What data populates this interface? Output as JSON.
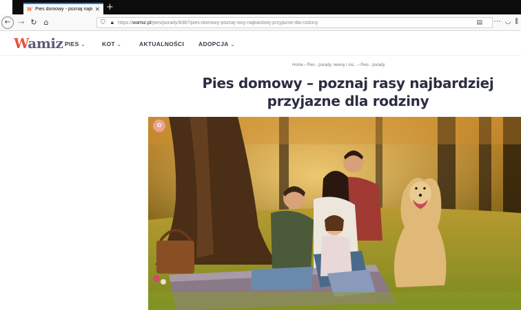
{
  "browser": {
    "tab_title": "Pies domowy - poznaj najlepsze",
    "url_domain": "wamiz.pl",
    "url_prefix": "https://",
    "url_path": "/pies/porady/8387/pies-domowy-poznaj-rasy-najbardziej-przyjazne-dla-rodziny",
    "icons": {
      "back": "arrow-left-icon",
      "forward": "arrow-right-icon",
      "reload": "reload-icon",
      "home": "home-icon",
      "shield": "shield-icon",
      "lock": "lock-icon",
      "reader": "reader-view-icon",
      "more": "more-icon",
      "pocket": "pocket-icon",
      "library": "library-icon"
    },
    "accent_color": "#0a84ff"
  },
  "site": {
    "logo_text_w": "W",
    "logo_text_rest": "amiz",
    "brand_color": "#e8503a",
    "menu": [
      {
        "label": "PIES",
        "has_dropdown": true
      },
      {
        "label": "KOT",
        "has_dropdown": true
      },
      {
        "label": "AKTUALNOŚCI",
        "has_dropdown": false
      },
      {
        "label": "ADOPCJA",
        "has_dropdown": true
      }
    ]
  },
  "article": {
    "breadcrumb": [
      "Home",
      "Pies - porady, newsy i cie...",
      "Pies - porady"
    ],
    "breadcrumb_sep": "›",
    "title_line1": "Pies domowy – poznaj rasy najbardziej",
    "title_line2": "przyjazne dla rodziny",
    "title_color": "#2b2d42"
  }
}
